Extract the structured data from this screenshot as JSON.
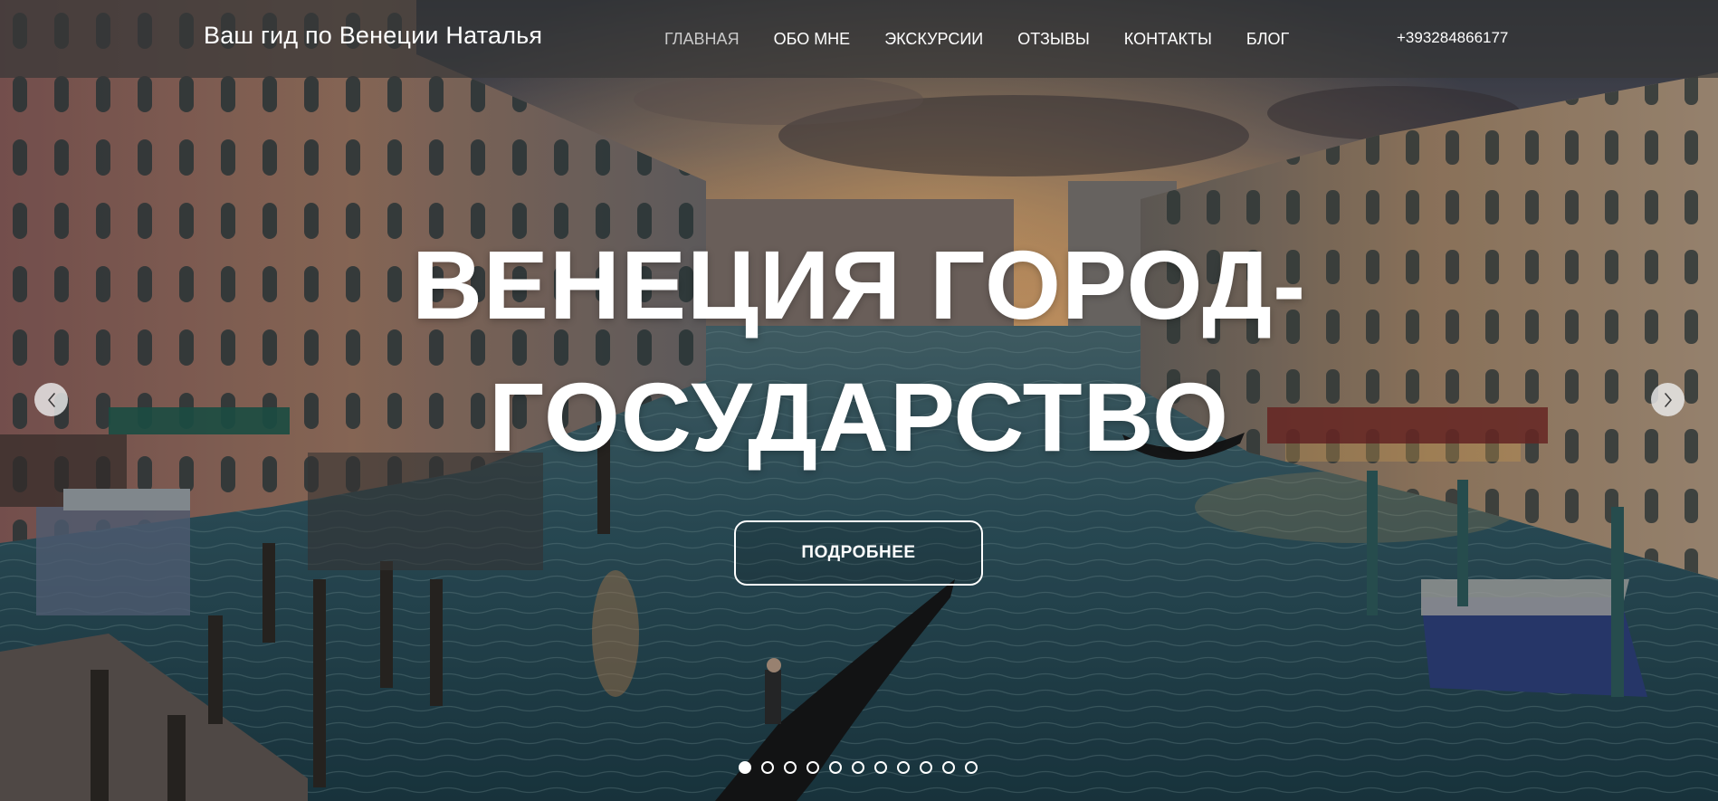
{
  "header": {
    "brand": "Ваш гид по Венеции Наталья",
    "nav": [
      {
        "label": "ГЛАВНАЯ",
        "active": true
      },
      {
        "label": "ОБО МНЕ",
        "active": false
      },
      {
        "label": "ЭКСКУРСИИ",
        "active": false
      },
      {
        "label": "ОТЗЫВЫ",
        "active": false
      },
      {
        "label": "КОНТАКТЫ",
        "active": false
      },
      {
        "label": "БЛОГ",
        "active": false
      }
    ],
    "phone": "+393284866177"
  },
  "hero": {
    "title_line1": "ВЕНЕЦИЯ ГОРОД-",
    "title_line2": "ГОСУДАРСТВО",
    "button_label": "ПОДРОБНЕЕ",
    "prev_icon": "chevron-left-icon",
    "next_icon": "chevron-right-icon"
  },
  "slider": {
    "slide_count": 11,
    "active_slide": 1
  },
  "colors": {
    "header_bg": "#373737",
    "text": "#ffffff",
    "nav_active": "#c9c9c9",
    "water": "#2f5560",
    "sky_glow": "#d9995a"
  }
}
